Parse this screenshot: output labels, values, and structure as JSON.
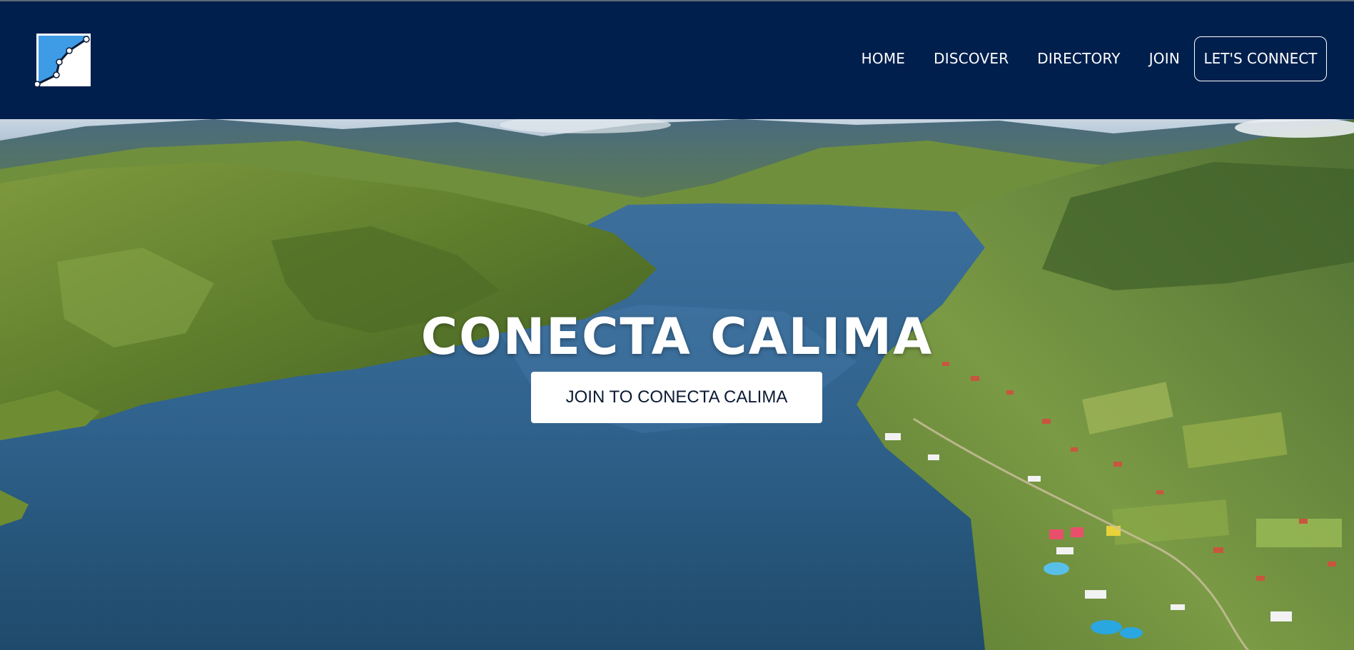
{
  "brand": {
    "logo_icon": "conecta-calima-logo"
  },
  "nav": {
    "items": [
      {
        "label": "HOME"
      },
      {
        "label": "DISCOVER"
      },
      {
        "label": "DIRECTORY"
      },
      {
        "label": "JOIN"
      }
    ],
    "cta_label": "LET'S CONNECT"
  },
  "hero": {
    "title": "CONECTA CALIMA",
    "button_label": "JOIN TO CONECTA CALIMA",
    "background": "lake-valley-aerial-photo"
  },
  "colors": {
    "header_bg": "#001f4d",
    "logo_blue": "#3e9be6",
    "text_white": "#ffffff",
    "button_text": "#0c1b33"
  }
}
